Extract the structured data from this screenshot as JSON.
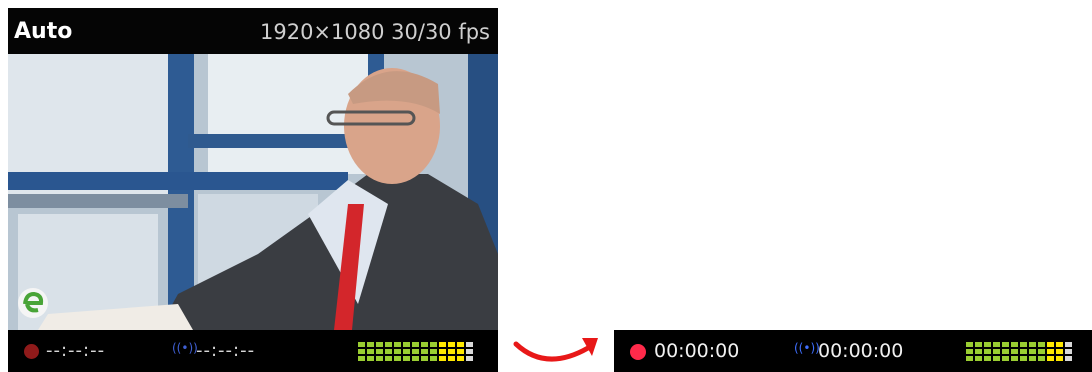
{
  "monitor": {
    "mode_label": "Auto",
    "resolution_label": "1920×1080 30/30 fps",
    "status": {
      "record_time": "--:--:--",
      "stream_time": "--:--:--",
      "record_icon": "record-dot-icon",
      "stream_icon": "broadcast-icon",
      "stream_icon_glyph": "((•))"
    },
    "audio_meter": {
      "columns": 13,
      "column_colors": [
        "#9acd32",
        "#9acd32",
        "#9acd32",
        "#9acd32",
        "#9acd32",
        "#9acd32",
        "#9acd32",
        "#9acd32",
        "#9acd32",
        "#ffe800",
        "#ffe800",
        "#ffe800",
        "#d9d9d9"
      ]
    }
  },
  "expanded": {
    "record_time": "00:00:00",
    "stream_time": "00:00:00",
    "stream_icon_glyph": "((•))",
    "record_dot_color": "#ff2a4a",
    "audio_meter": {
      "columns": 12,
      "column_colors": [
        "#9acd32",
        "#9acd32",
        "#9acd32",
        "#9acd32",
        "#9acd32",
        "#9acd32",
        "#9acd32",
        "#9acd32",
        "#9acd32",
        "#ffe800",
        "#ffe800",
        "#d9d9d9"
      ]
    }
  },
  "colors": {
    "arrow": "#e81818",
    "stream_blue": "#3f6fff",
    "record_red_dim": "#8f1a1a"
  }
}
